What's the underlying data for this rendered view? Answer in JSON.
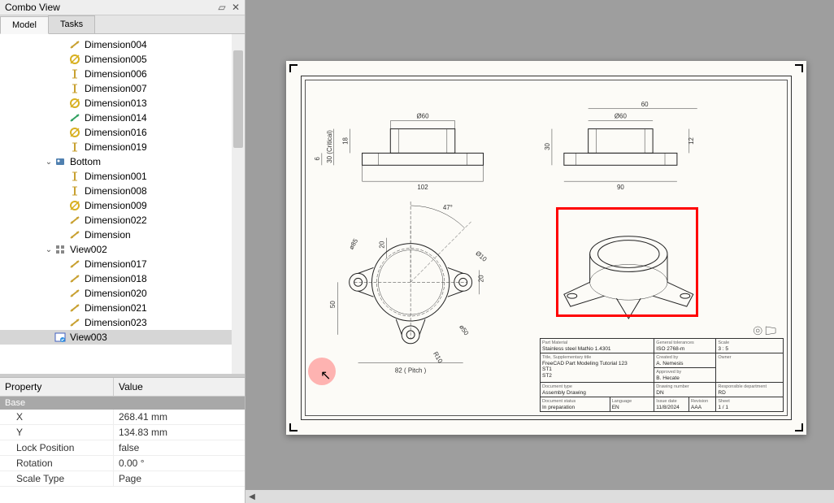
{
  "panel": {
    "title": "Combo View",
    "tabs": [
      "Model",
      "Tasks"
    ],
    "activeTab": 0
  },
  "tree": [
    {
      "depth": 4,
      "icon": "dim-dist",
      "label": "Dimension004"
    },
    {
      "depth": 4,
      "icon": "dim-dia",
      "label": "Dimension005"
    },
    {
      "depth": 4,
      "icon": "dim-vert",
      "label": "Dimension006"
    },
    {
      "depth": 4,
      "icon": "dim-vert",
      "label": "Dimension007"
    },
    {
      "depth": 4,
      "icon": "dim-dia",
      "label": "Dimension013"
    },
    {
      "depth": 4,
      "icon": "dim-dist2",
      "label": "Dimension014"
    },
    {
      "depth": 4,
      "icon": "dim-dia",
      "label": "Dimension016"
    },
    {
      "depth": 4,
      "icon": "dim-vert",
      "label": "Dimension019"
    },
    {
      "depth": 3,
      "icon": "view",
      "label": "Bottom",
      "expander": "open"
    },
    {
      "depth": 4,
      "icon": "dim-vert",
      "label": "Dimension001"
    },
    {
      "depth": 4,
      "icon": "dim-vert",
      "label": "Dimension008"
    },
    {
      "depth": 4,
      "icon": "dim-dia",
      "label": "Dimension009"
    },
    {
      "depth": 4,
      "icon": "dim-dist",
      "label": "Dimension022"
    },
    {
      "depth": 4,
      "icon": "dim-dist",
      "label": "Dimension"
    },
    {
      "depth": 3,
      "icon": "group",
      "label": "View002",
      "expander": "open"
    },
    {
      "depth": 4,
      "icon": "dim-dist",
      "label": "Dimension017"
    },
    {
      "depth": 4,
      "icon": "dim-dist",
      "label": "Dimension018"
    },
    {
      "depth": 4,
      "icon": "dim-dist",
      "label": "Dimension020"
    },
    {
      "depth": 4,
      "icon": "dim-dist",
      "label": "Dimension021"
    },
    {
      "depth": 4,
      "icon": "dim-dist",
      "label": "Dimension023"
    },
    {
      "depth": 3,
      "icon": "viewsel",
      "label": "View003",
      "selected": true
    }
  ],
  "properties": {
    "group": "Base",
    "rows": [
      {
        "name": "X",
        "value": "268.41 mm"
      },
      {
        "name": "Y",
        "value": "134.83 mm"
      },
      {
        "name": "Lock Position",
        "value": "false"
      },
      {
        "name": "Rotation",
        "value": "0.00 °"
      },
      {
        "name": "Scale Type",
        "value": "Page"
      }
    ],
    "headProp": "Property",
    "headVal": "Value"
  },
  "drawing": {
    "top1": {
      "dia": "Ø60",
      "width": "102",
      "h1": "18",
      "h2": "30 (Critical)",
      "base": "6"
    },
    "top2": {
      "dia": "Ø60",
      "width": "90",
      "span": "60",
      "h": "30",
      "t": "12"
    },
    "bottom": {
      "angle": "47°",
      "dia85": "ø85",
      "d20a": "20",
      "d20b": "20",
      "d50": "50",
      "dia10": "Ø10",
      "dia50": "ø50",
      "r10": "R10",
      "pitch": "82 ( Pitch )"
    }
  },
  "titleBlock": {
    "material_lbl": "Part Material",
    "material": "Stainless steel MatNo 1.4301",
    "tol_lbl": "General tolerances",
    "tol": "ISO 2768-m",
    "scale_lbl": "Scale",
    "scale": "3 : 5",
    "title_lbl": "Title, Supplementary title",
    "title1": "FreeCAD Part Modeling Tutorial 123",
    "title2": "ST1",
    "title3": "ST2",
    "created_lbl": "Created by",
    "created": "A. Nemesis",
    "approved_lbl": "Approved by",
    "approved": "B. Hecate",
    "owner_lbl": "Owner",
    "doctype_lbl": "Document type",
    "doctype": "Assembly Drawing",
    "dn_lbl": "Drawing number",
    "dn": "DN",
    "status_lbl": "Document status",
    "status": "In preparation",
    "lang_lbl": "Language",
    "lang": "EN",
    "date_lbl": "Issue date",
    "date": "11/8/2024",
    "rev_lbl": "Revision",
    "rev": "AAA",
    "sheet_lbl": "Sheet",
    "sheet": "1 / 1",
    "resp_lbl": "Responsible department",
    "resp": "RD"
  }
}
